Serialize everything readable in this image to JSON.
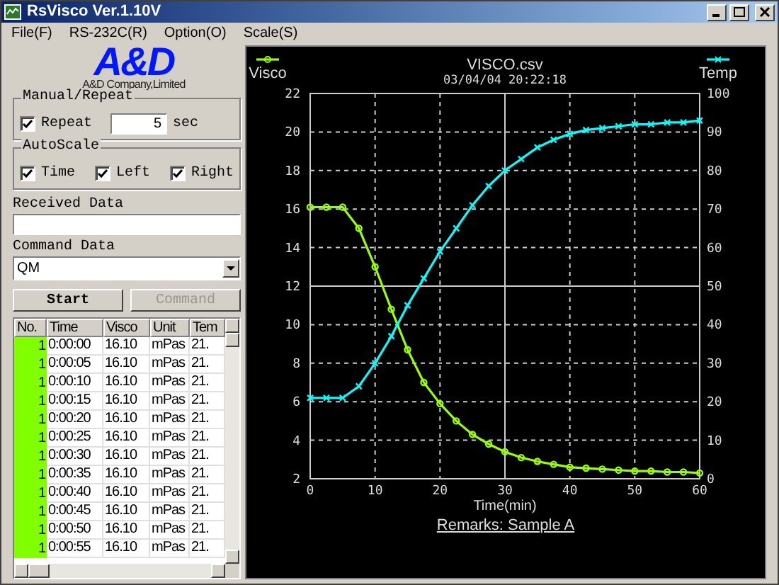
{
  "window": {
    "title": "RsVisco Ver.1.10V"
  },
  "menu": [
    {
      "label": "File(F)"
    },
    {
      "label": "RS-232C(R)"
    },
    {
      "label": "Option(O)"
    },
    {
      "label": "Scale(S)"
    }
  ],
  "logo": {
    "mark": "A&D",
    "company": "A&D Company,Limited"
  },
  "manual_repeat": {
    "title": "Manual/Repeat",
    "repeat": {
      "label": "Repeat",
      "checked": true
    },
    "interval": "5",
    "unit": "sec"
  },
  "autoscale": {
    "title": "AutoScale",
    "options": [
      {
        "label": "Time",
        "checked": true
      },
      {
        "label": "Left",
        "checked": true
      },
      {
        "label": "Right",
        "checked": true
      }
    ]
  },
  "received_data": {
    "label": "Received Data"
  },
  "command_data": {
    "label": "Command Data",
    "value": "QM"
  },
  "buttons": [
    {
      "label": "Start",
      "disabled": false
    },
    {
      "label": "Command",
      "disabled": true
    }
  ],
  "table": {
    "columns": [
      "No.",
      "Time",
      "Visco",
      "Unit",
      "Tem"
    ],
    "rows": [
      {
        "cells": [
          "1",
          "0:00:00",
          "16.10",
          "mPas",
          "21."
        ],
        "color": "#80ff00"
      },
      {
        "cells": [
          "1",
          "0:00:05",
          "16.10",
          "mPas",
          "21."
        ],
        "color": "#80ff00"
      },
      {
        "cells": [
          "1",
          "0:00:10",
          "16.10",
          "mPas",
          "21."
        ],
        "color": "#80ff00"
      },
      {
        "cells": [
          "1",
          "0:00:15",
          "16.10",
          "mPas",
          "21."
        ],
        "color": "#80ff00"
      },
      {
        "cells": [
          "1",
          "0:00:20",
          "16.10",
          "mPas",
          "21."
        ],
        "color": "#80ff00"
      },
      {
        "cells": [
          "1",
          "0:00:25",
          "16.10",
          "mPas",
          "21."
        ],
        "color": "#80ff00"
      },
      {
        "cells": [
          "1",
          "0:00:30",
          "16.10",
          "mPas",
          "21."
        ],
        "color": "#80ff00"
      },
      {
        "cells": [
          "1",
          "0:00:35",
          "16.10",
          "mPas",
          "21."
        ],
        "color": "#80ff00"
      },
      {
        "cells": [
          "1",
          "0:00:40",
          "16.10",
          "mPas",
          "21."
        ],
        "color": "#80ff00"
      },
      {
        "cells": [
          "1",
          "0:00:45",
          "16.10",
          "mPas",
          "21."
        ],
        "color": "#80ff00"
      },
      {
        "cells": [
          "1",
          "0:00:50",
          "16.10",
          "mPas",
          "21."
        ],
        "color": "#80ff00"
      },
      {
        "cells": [
          "1",
          "0:00:55",
          "16.10",
          "mPas",
          "21."
        ],
        "color": "#80ff00"
      }
    ]
  },
  "chart": {
    "timestamp": "03/04/04 20:22:18",
    "remarks": "Remarks: Sample A",
    "chart_data": {
      "type": "line",
      "title": "VISCO.csv",
      "xlabel": "Time(min)",
      "x": [
        0,
        2.5,
        5,
        7.5,
        10,
        12.5,
        15,
        17.5,
        20,
        22.5,
        25,
        27.5,
        30,
        32.5,
        35,
        37.5,
        40,
        42.5,
        45,
        47.5,
        50,
        52.5,
        55,
        57.5,
        60
      ],
      "series": [
        {
          "name": "Visco",
          "color": "#99ff00",
          "marker": "circle",
          "values": [
            16.1,
            16.1,
            16.1,
            15.0,
            13.0,
            10.8,
            8.7,
            7.0,
            5.9,
            5.0,
            4.3,
            3.8,
            3.4,
            3.1,
            2.9,
            2.75,
            2.6,
            2.55,
            2.5,
            2.45,
            2.4,
            2.4,
            2.35,
            2.35,
            2.3
          ]
        },
        {
          "name": "Temp",
          "color": "#00ffff",
          "axis": "y2",
          "marker": "x",
          "values": [
            21,
            21,
            21,
            24,
            30,
            37,
            45,
            52,
            59,
            65,
            71,
            76,
            80,
            83,
            86,
            88,
            89.5,
            90.5,
            91,
            91.5,
            92,
            92,
            92.5,
            92.5,
            93
          ]
        }
      ],
      "grid": true,
      "legend": "top",
      "xlim": [
        0,
        60
      ],
      "ylim": [
        2,
        22
      ],
      "y2lim": [
        0,
        100
      ],
      "xticks": [
        0,
        10,
        20,
        30,
        40,
        50,
        60
      ],
      "yticks": [
        2,
        4,
        6,
        8,
        10,
        12,
        14,
        16,
        18,
        20,
        22
      ],
      "y2ticks": [
        0,
        10,
        20,
        30,
        40,
        50,
        60,
        70,
        80,
        90,
        100
      ]
    }
  }
}
